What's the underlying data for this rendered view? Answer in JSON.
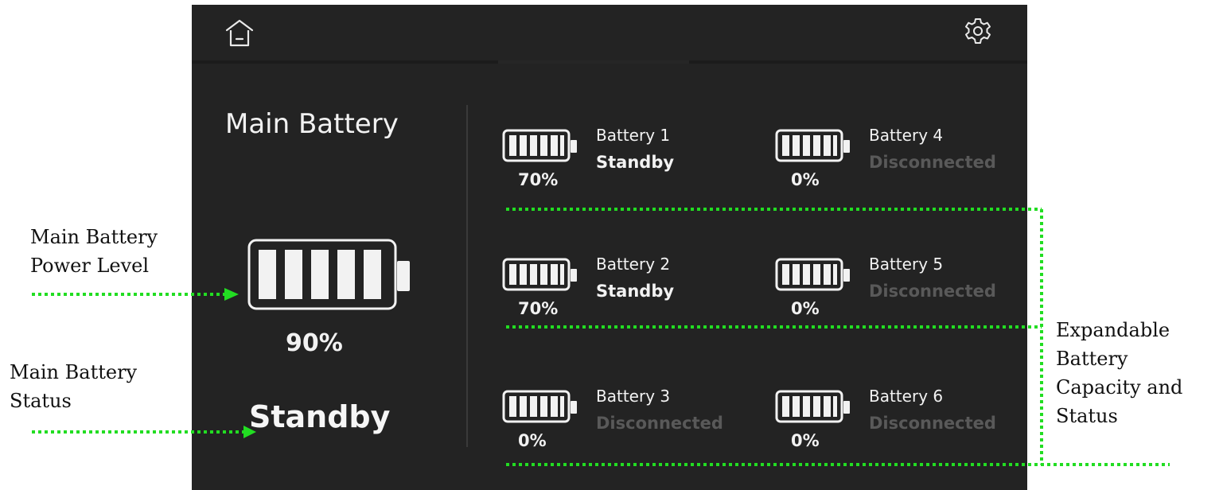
{
  "topbar": {
    "home_icon": "home-icon",
    "settings_icon": "gear-icon"
  },
  "main_battery": {
    "title": "Main Battery",
    "percent": "90%",
    "status": "Standby",
    "level_fraction": 0.9
  },
  "sub_batteries": [
    {
      "name": "Battery 1",
      "status": "Standby",
      "percent": "70%"
    },
    {
      "name": "Battery 2",
      "status": "Standby",
      "percent": "70%"
    },
    {
      "name": "Battery 3",
      "status": "Disconnected",
      "percent": "0%"
    },
    {
      "name": "Battery 4",
      "status": "Disconnected",
      "percent": "0%"
    },
    {
      "name": "Battery 5",
      "status": "Disconnected",
      "percent": "0%"
    },
    {
      "name": "Battery 6",
      "status": "Disconnected",
      "percent": "0%"
    }
  ],
  "annotations": {
    "power_level": [
      "Main Battery",
      "Power Level"
    ],
    "status": [
      "Main Battery",
      "Status"
    ],
    "expandable": [
      "Expandable",
      "Battery",
      "Capacity and",
      "Status"
    ]
  },
  "colors": {
    "screen_bg": "#232323",
    "text": "#f2f2f2",
    "disconnected": "#595959",
    "annotation_arrow": "#22dd22"
  }
}
